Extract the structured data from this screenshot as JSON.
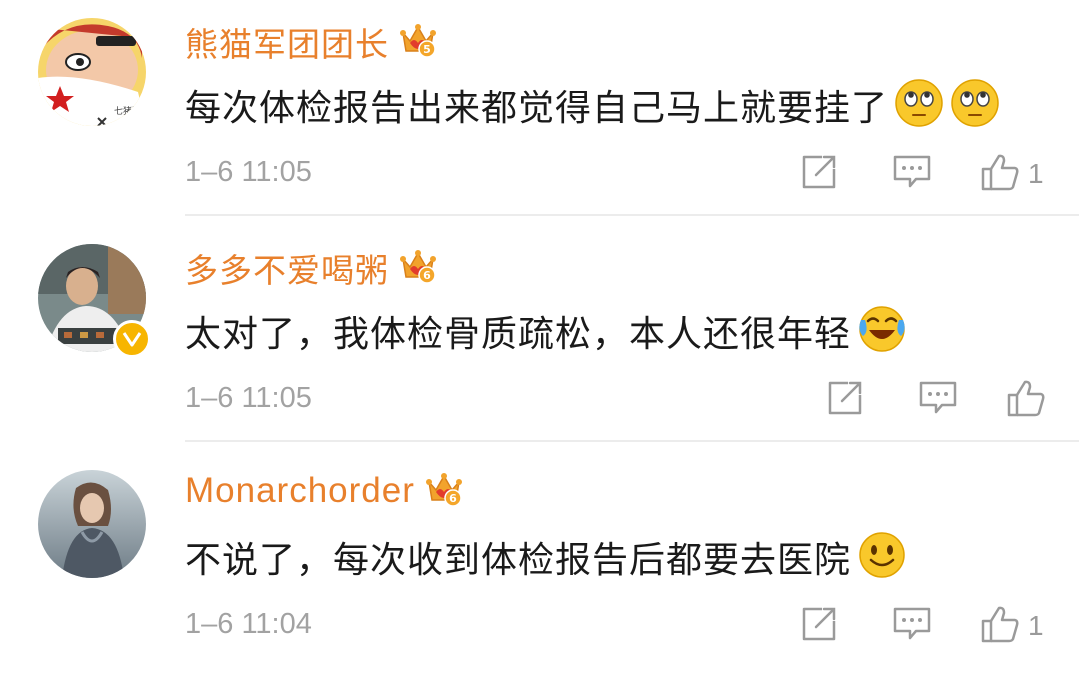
{
  "comments": [
    {
      "username": "熊猫军团团长",
      "level_badge": "5",
      "text": "每次体检报告出来都觉得自己马上就要挂了",
      "emoji": [
        "eye-roll-emoji",
        "eye-roll-emoji"
      ],
      "time": "1–6 11:05",
      "like_count": "1"
    },
    {
      "username": "多多不爱喝粥",
      "level_badge": "6",
      "text": "太对了，我体检骨质疏松，本人还很年轻",
      "emoji": [
        "laugh-cry-emoji"
      ],
      "time": "1–6 11:05",
      "like_count": ""
    },
    {
      "username": "Monarchorder",
      "level_badge": "6",
      "text": "不说了，每次收到体检报告后都要去医院",
      "emoji": [
        "smile-emoji"
      ],
      "time": "1–6 11:04",
      "like_count": "1"
    }
  ],
  "colors": {
    "username": "#e8802c",
    "text": "#1a1a1a",
    "meta": "#a2a2a2",
    "verified_badge": "#f7b500"
  }
}
